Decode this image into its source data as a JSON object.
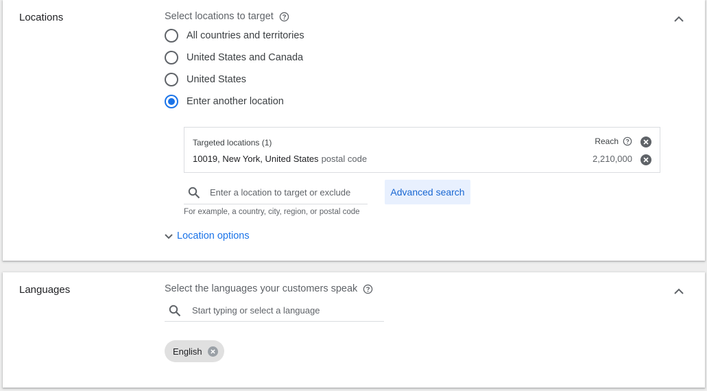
{
  "locations": {
    "title": "Locations",
    "prompt": "Select locations to target",
    "options": [
      {
        "label": "All countries and territories",
        "checked": false
      },
      {
        "label": "United States and Canada",
        "checked": false
      },
      {
        "label": "United States",
        "checked": false
      },
      {
        "label": "Enter another location",
        "checked": true
      }
    ],
    "targeted": {
      "header": "Targeted locations (1)",
      "reach_label": "Reach",
      "location_name": "10019, New York, United States",
      "location_type": "postal code",
      "reach_value": "2,210,000"
    },
    "search": {
      "placeholder": "Enter a location to target or exclude",
      "hint": "For example, a country, city, region, or postal code"
    },
    "advanced_search_label": "Advanced search",
    "location_options_label": "Location options"
  },
  "languages": {
    "title": "Languages",
    "prompt": "Select the languages your customers speak",
    "search": {
      "placeholder": "Start typing or select a language"
    },
    "selected": [
      "English"
    ]
  },
  "colors": {
    "accent": "#1a73e8",
    "advanced_bg": "#e8f0fe",
    "chip_bg": "#e0e0e0",
    "page_bg": "#eeeeee"
  }
}
